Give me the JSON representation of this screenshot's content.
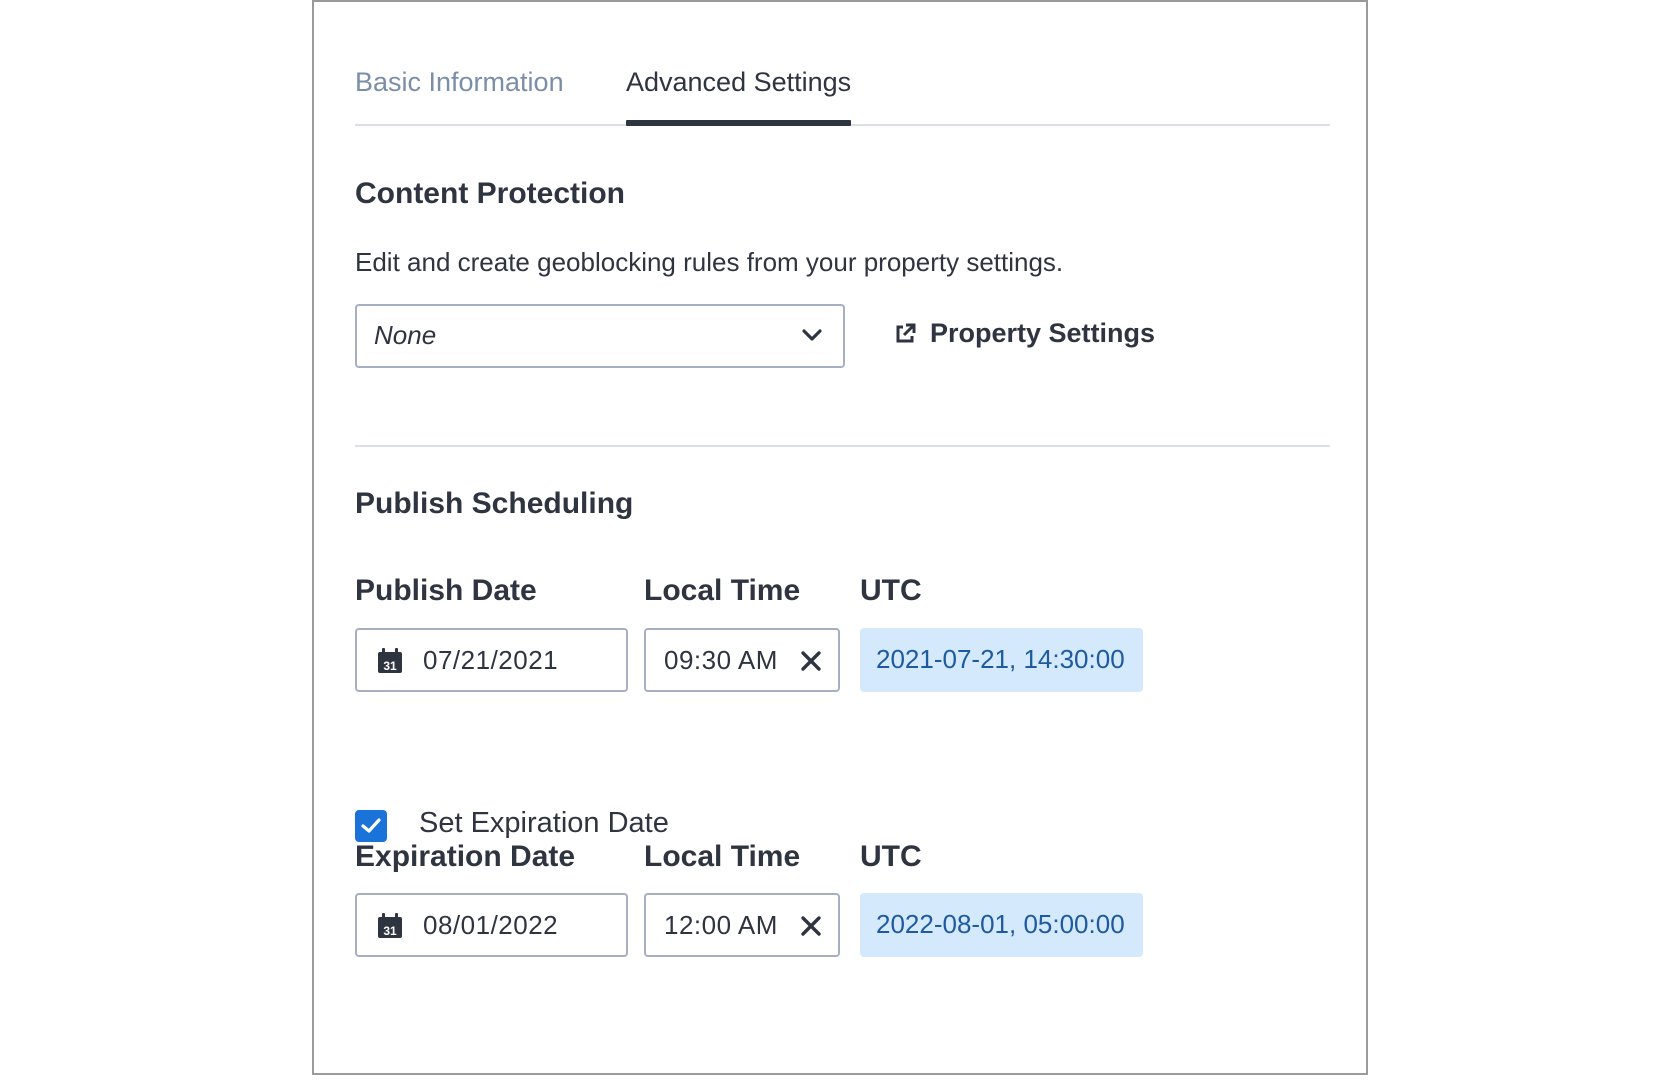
{
  "tabs": [
    {
      "label": "Basic Information",
      "active": false
    },
    {
      "label": "Advanced Settings",
      "active": true
    }
  ],
  "content_protection": {
    "title": "Content Protection",
    "description": "Edit and create geoblocking rules from your property settings.",
    "select_value": "None",
    "link_label": "Property Settings"
  },
  "publish_scheduling": {
    "title": "Publish Scheduling",
    "publish": {
      "date_label": "Publish Date",
      "time_label": "Local Time",
      "utc_label": "UTC",
      "date_value": "07/21/2021",
      "time_value": "09:30 AM",
      "utc_value": "2021-07-21, 14:30:00"
    },
    "expiration_checkbox": {
      "label": "Set Expiration Date",
      "checked": true
    },
    "expiration": {
      "date_label": "Expiration Date",
      "time_label": "Local Time",
      "utc_label": "UTC",
      "date_value": "08/01/2022",
      "time_value": "12:00 AM",
      "utc_value": "2022-08-01, 05:00:00"
    }
  },
  "icons": {
    "calendar_text": "31",
    "dropdown": "chevron-down-icon",
    "external": "external-link-icon",
    "clear": "close-icon"
  },
  "colors": {
    "text": "#2f3441",
    "tab_inactive": "#7b8ea8",
    "accent": "#1a73d9",
    "utc_bg": "#d4e9fb",
    "utc_text": "#1e5aa0",
    "border": "#a6afc1"
  }
}
